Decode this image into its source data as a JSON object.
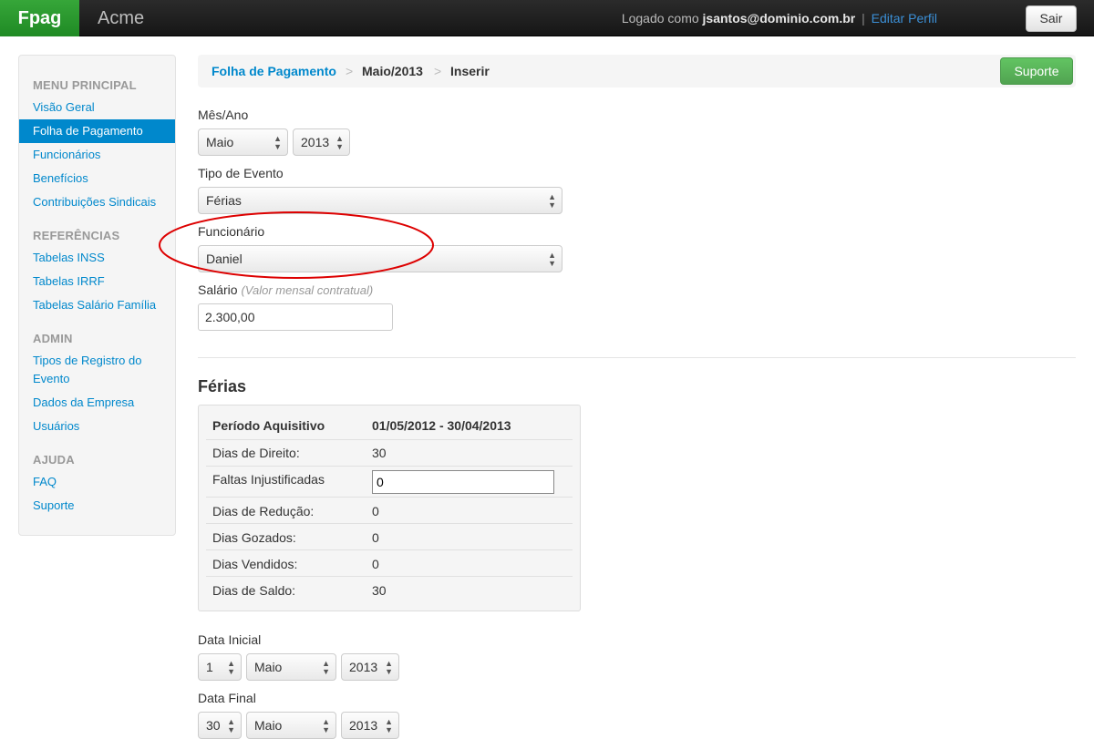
{
  "topbar": {
    "brand": "Fpag",
    "company": "Acme",
    "logged_as": "Logado como",
    "email": "jsantos@dominio.com.br",
    "separator": "|",
    "edit_profile": "Editar Perfil",
    "logout": "Sair"
  },
  "sidebar": {
    "sections": [
      {
        "header": "MENU PRINCIPAL",
        "items": [
          "Visão Geral",
          "Folha de Pagamento",
          "Funcionários",
          "Benefícios",
          "Contribuições Sindicais"
        ]
      },
      {
        "header": "REFERÊNCIAS",
        "items": [
          "Tabelas INSS",
          "Tabelas IRRF",
          "Tabelas Salário Família"
        ]
      },
      {
        "header": "ADMIN",
        "items": [
          "Tipos de Registro do",
          "Evento",
          "Dados da Empresa",
          "Usuários"
        ]
      },
      {
        "header": "AJUDA",
        "items": [
          "FAQ",
          "Suporte"
        ]
      }
    ],
    "active_item": "Folha de Pagamento"
  },
  "breadcrumb": {
    "items": [
      "Folha de Pagamento",
      "Maio/2013",
      "Inserir"
    ],
    "divider": ">"
  },
  "support_button": "Suporte",
  "form": {
    "mes_ano": {
      "label": "Mês/Ano",
      "month": "Maio",
      "year": "2013"
    },
    "tipo_evento": {
      "label": "Tipo de Evento",
      "value": "Férias"
    },
    "funcionario": {
      "label": "Funcionário",
      "value": "Daniel"
    },
    "salario": {
      "label": "Salário",
      "hint": "(Valor mensal contratual)",
      "value": "2.300,00"
    }
  },
  "ferias": {
    "title": "Férias",
    "header": {
      "label": "Período Aquisitivo",
      "value": "01/05/2012 - 30/04/2013"
    },
    "rows": [
      {
        "label": "Dias de Direito:",
        "value": "30"
      },
      {
        "label": "Faltas Injustificadas",
        "value": "0"
      },
      {
        "label": "Dias de Redução:",
        "value": "0"
      },
      {
        "label": "Dias Gozados:",
        "value": "0"
      },
      {
        "label": "Dias Vendidos:",
        "value": "0"
      },
      {
        "label": "Dias de Saldo:",
        "value": "30"
      }
    ]
  },
  "data_inicial": {
    "label": "Data Inicial",
    "day": "1",
    "month": "Maio",
    "year": "2013"
  },
  "data_final": {
    "label": "Data Final",
    "day": "30",
    "month": "Maio",
    "year": "2013"
  },
  "annotation_color": "#dd0000"
}
